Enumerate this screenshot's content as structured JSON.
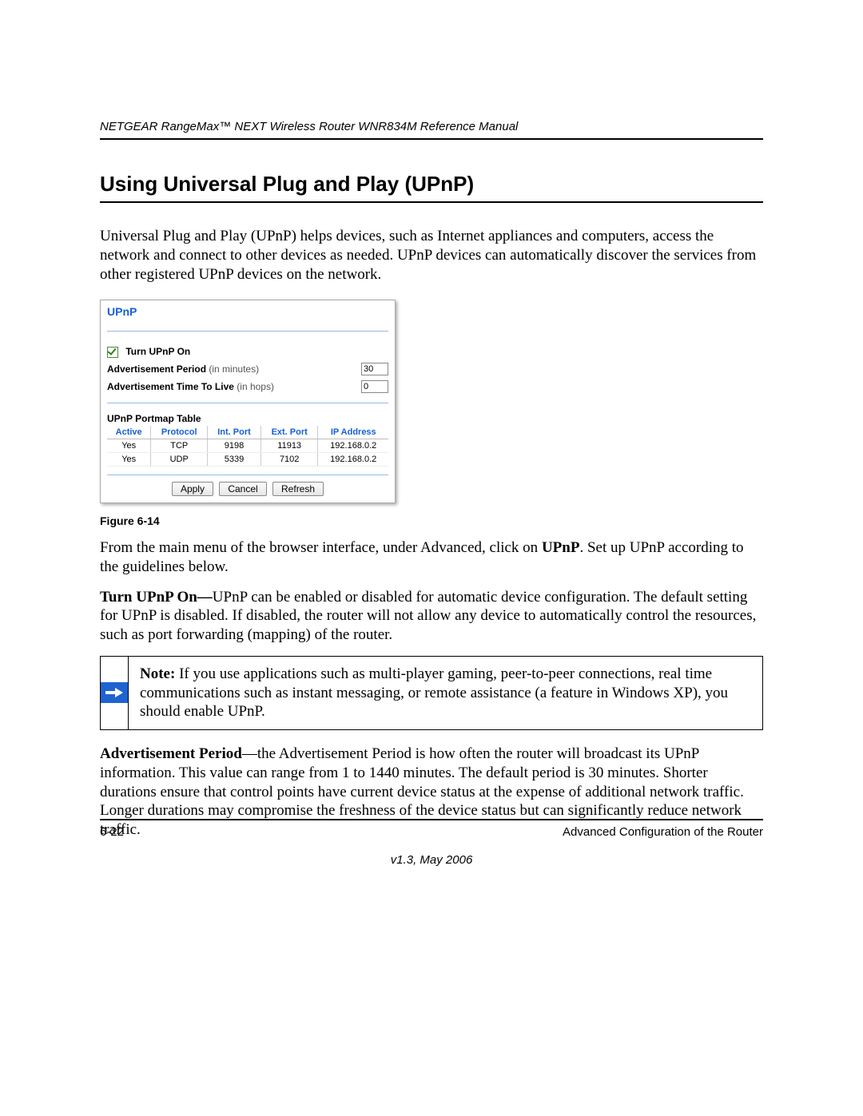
{
  "header": {
    "running": "NETGEAR RangeMax™ NEXT Wireless Router WNR834M Reference Manual"
  },
  "title": "Using Universal Plug and Play (UPnP)",
  "intro": "Universal Plug and Play (UPnP) helps devices, such as Internet appliances and computers, access the network and connect to other devices as needed. UPnP devices can automatically discover the services from other registered UPnP devices on the network.",
  "figure": {
    "panel_title": "UPnP",
    "turn_on_label": "Turn UPnP On",
    "adv_period_label": "Advertisement Period",
    "adv_period_hint": "(in minutes)",
    "adv_period_value": "30",
    "ttl_label": "Advertisement Time To Live",
    "ttl_hint": "(in hops)",
    "ttl_value": "0",
    "portmap_title": "UPnP Portmap Table",
    "columns": [
      "Active",
      "Protocol",
      "Int. Port",
      "Ext. Port",
      "IP Address"
    ],
    "rows": [
      [
        "Yes",
        "TCP",
        "9198",
        "11913",
        "192.168.0.2"
      ],
      [
        "Yes",
        "UDP",
        "5339",
        "7102",
        "192.168.0.2"
      ]
    ],
    "buttons": {
      "apply": "Apply",
      "cancel": "Cancel",
      "refresh": "Refresh"
    },
    "caption": "Figure 6-14"
  },
  "para_after_figure_prefix": "From the main menu of the browser interface, under Advanced, click on ",
  "para_after_figure_bold": "UPnP",
  "para_after_figure_suffix": ". Set up UPnP according to the guidelines below.",
  "turn_on_heading": "Turn UPnP On—",
  "turn_on_body": "UPnP can be enabled or disabled for automatic device configuration. The default setting for UPnP is disabled. If disabled, the router will not allow any device to automatically control the resources, such as port forwarding (mapping) of the router.",
  "note_label": "Note:",
  "note_body": " If you use applications such as multi-player gaming, peer-to-peer connections, real time communications such as instant messaging, or remote assistance (a feature in Windows XP), you should enable UPnP.",
  "adv_period_heading": "Advertisement Period",
  "adv_period_body": "—the Advertisement Period is how often the router will broadcast its UPnP information. This value can range from 1 to 1440 minutes. The default period is 30 minutes. Shorter durations ensure that control points have current device status at the expense of additional network traffic. Longer durations may compromise the freshness of the device status but can significantly reduce network traffic.",
  "footer": {
    "page": "6-22",
    "section": "Advanced Configuration of the Router",
    "version": "v1.3, May 2006"
  }
}
